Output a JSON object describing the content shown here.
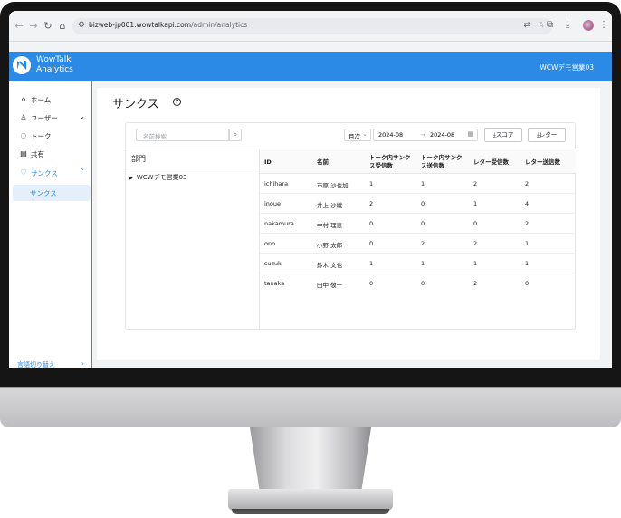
{
  "browser": {
    "url_host": "bizweb-jp001.wowtalkapi.com",
    "url_path": "/admin/analytics"
  },
  "app": {
    "title_line1": "WowTalk",
    "title_line2": "Analytics",
    "company": "WCWデモ営業03"
  },
  "sidebar": {
    "items": [
      {
        "label": "ホーム",
        "icon": "home-icon"
      },
      {
        "label": "ユーザー",
        "icon": "user-icon"
      },
      {
        "label": "トーク",
        "icon": "chat-icon"
      },
      {
        "label": "共有",
        "icon": "document-icon"
      },
      {
        "label": "サンクス",
        "icon": "heart-icon"
      }
    ],
    "sub_item": "サンクス",
    "language_switch": "言語切り替え"
  },
  "page": {
    "title": "サンクス"
  },
  "filters": {
    "search_placeholder": "名前検索",
    "period": "月次",
    "start": "2024-08",
    "end": "2024-08",
    "score_button": "スコア",
    "letter_button": "レター"
  },
  "tree": {
    "header": "部門",
    "node": "WCWデモ営業03"
  },
  "table": {
    "headers": [
      {
        "line1": "ID",
        "line2": ""
      },
      {
        "line1": "名前",
        "line2": ""
      },
      {
        "line1": "トーク内サンク",
        "line2": "ス受信数"
      },
      {
        "line1": "トーク内サンク",
        "line2": "ス送信数"
      },
      {
        "line1": "レター受信数",
        "line2": ""
      },
      {
        "line1": "レター送信数",
        "line2": ""
      }
    ],
    "rows": [
      [
        "ichihara",
        "市原 沙也加",
        "1",
        "1",
        "2",
        "2"
      ],
      [
        "inoue",
        "井上 沙織",
        "2",
        "0",
        "1",
        "4"
      ],
      [
        "nakamura",
        "中村 理恵",
        "0",
        "0",
        "0",
        "2"
      ],
      [
        "ono",
        "小野 太郎",
        "0",
        "2",
        "2",
        "1"
      ],
      [
        "suzuki",
        "鈴木 文也",
        "1",
        "1",
        "1",
        "1"
      ],
      [
        "tanaka",
        "田中 敬一",
        "0",
        "0",
        "2",
        "0"
      ]
    ]
  },
  "colors": {
    "accent": "#2b8ae6",
    "sidebar_active_bg": "#e3f0fc"
  }
}
